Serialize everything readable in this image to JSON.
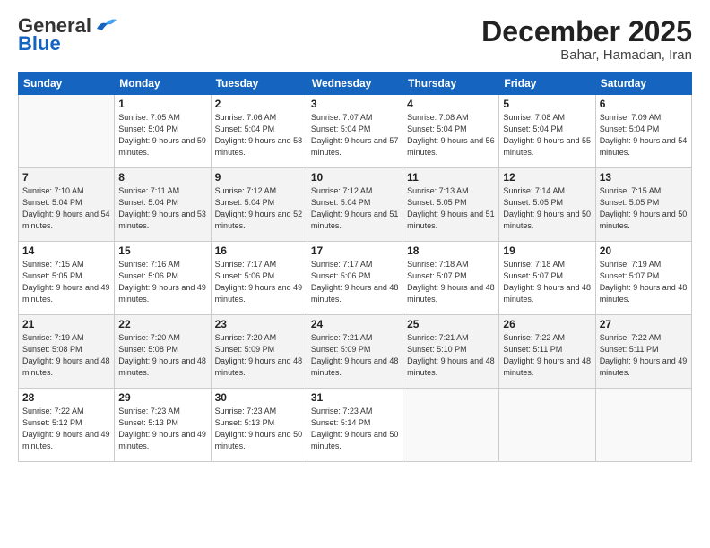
{
  "header": {
    "logo_general": "General",
    "logo_blue": "Blue",
    "month_title": "December 2025",
    "subtitle": "Bahar, Hamadan, Iran"
  },
  "weekdays": [
    "Sunday",
    "Monday",
    "Tuesday",
    "Wednesday",
    "Thursday",
    "Friday",
    "Saturday"
  ],
  "weeks": [
    [
      {
        "day": "",
        "sunrise": "",
        "sunset": "",
        "daylight": ""
      },
      {
        "day": "1",
        "sunrise": "Sunrise: 7:05 AM",
        "sunset": "Sunset: 5:04 PM",
        "daylight": "Daylight: 9 hours and 59 minutes."
      },
      {
        "day": "2",
        "sunrise": "Sunrise: 7:06 AM",
        "sunset": "Sunset: 5:04 PM",
        "daylight": "Daylight: 9 hours and 58 minutes."
      },
      {
        "day": "3",
        "sunrise": "Sunrise: 7:07 AM",
        "sunset": "Sunset: 5:04 PM",
        "daylight": "Daylight: 9 hours and 57 minutes."
      },
      {
        "day": "4",
        "sunrise": "Sunrise: 7:08 AM",
        "sunset": "Sunset: 5:04 PM",
        "daylight": "Daylight: 9 hours and 56 minutes."
      },
      {
        "day": "5",
        "sunrise": "Sunrise: 7:08 AM",
        "sunset": "Sunset: 5:04 PM",
        "daylight": "Daylight: 9 hours and 55 minutes."
      },
      {
        "day": "6",
        "sunrise": "Sunrise: 7:09 AM",
        "sunset": "Sunset: 5:04 PM",
        "daylight": "Daylight: 9 hours and 54 minutes."
      }
    ],
    [
      {
        "day": "7",
        "sunrise": "Sunrise: 7:10 AM",
        "sunset": "Sunset: 5:04 PM",
        "daylight": "Daylight: 9 hours and 54 minutes."
      },
      {
        "day": "8",
        "sunrise": "Sunrise: 7:11 AM",
        "sunset": "Sunset: 5:04 PM",
        "daylight": "Daylight: 9 hours and 53 minutes."
      },
      {
        "day": "9",
        "sunrise": "Sunrise: 7:12 AM",
        "sunset": "Sunset: 5:04 PM",
        "daylight": "Daylight: 9 hours and 52 minutes."
      },
      {
        "day": "10",
        "sunrise": "Sunrise: 7:12 AM",
        "sunset": "Sunset: 5:04 PM",
        "daylight": "Daylight: 9 hours and 51 minutes."
      },
      {
        "day": "11",
        "sunrise": "Sunrise: 7:13 AM",
        "sunset": "Sunset: 5:05 PM",
        "daylight": "Daylight: 9 hours and 51 minutes."
      },
      {
        "day": "12",
        "sunrise": "Sunrise: 7:14 AM",
        "sunset": "Sunset: 5:05 PM",
        "daylight": "Daylight: 9 hours and 50 minutes."
      },
      {
        "day": "13",
        "sunrise": "Sunrise: 7:15 AM",
        "sunset": "Sunset: 5:05 PM",
        "daylight": "Daylight: 9 hours and 50 minutes."
      }
    ],
    [
      {
        "day": "14",
        "sunrise": "Sunrise: 7:15 AM",
        "sunset": "Sunset: 5:05 PM",
        "daylight": "Daylight: 9 hours and 49 minutes."
      },
      {
        "day": "15",
        "sunrise": "Sunrise: 7:16 AM",
        "sunset": "Sunset: 5:06 PM",
        "daylight": "Daylight: 9 hours and 49 minutes."
      },
      {
        "day": "16",
        "sunrise": "Sunrise: 7:17 AM",
        "sunset": "Sunset: 5:06 PM",
        "daylight": "Daylight: 9 hours and 49 minutes."
      },
      {
        "day": "17",
        "sunrise": "Sunrise: 7:17 AM",
        "sunset": "Sunset: 5:06 PM",
        "daylight": "Daylight: 9 hours and 48 minutes."
      },
      {
        "day": "18",
        "sunrise": "Sunrise: 7:18 AM",
        "sunset": "Sunset: 5:07 PM",
        "daylight": "Daylight: 9 hours and 48 minutes."
      },
      {
        "day": "19",
        "sunrise": "Sunrise: 7:18 AM",
        "sunset": "Sunset: 5:07 PM",
        "daylight": "Daylight: 9 hours and 48 minutes."
      },
      {
        "day": "20",
        "sunrise": "Sunrise: 7:19 AM",
        "sunset": "Sunset: 5:07 PM",
        "daylight": "Daylight: 9 hours and 48 minutes."
      }
    ],
    [
      {
        "day": "21",
        "sunrise": "Sunrise: 7:19 AM",
        "sunset": "Sunset: 5:08 PM",
        "daylight": "Daylight: 9 hours and 48 minutes."
      },
      {
        "day": "22",
        "sunrise": "Sunrise: 7:20 AM",
        "sunset": "Sunset: 5:08 PM",
        "daylight": "Daylight: 9 hours and 48 minutes."
      },
      {
        "day": "23",
        "sunrise": "Sunrise: 7:20 AM",
        "sunset": "Sunset: 5:09 PM",
        "daylight": "Daylight: 9 hours and 48 minutes."
      },
      {
        "day": "24",
        "sunrise": "Sunrise: 7:21 AM",
        "sunset": "Sunset: 5:09 PM",
        "daylight": "Daylight: 9 hours and 48 minutes."
      },
      {
        "day": "25",
        "sunrise": "Sunrise: 7:21 AM",
        "sunset": "Sunset: 5:10 PM",
        "daylight": "Daylight: 9 hours and 48 minutes."
      },
      {
        "day": "26",
        "sunrise": "Sunrise: 7:22 AM",
        "sunset": "Sunset: 5:11 PM",
        "daylight": "Daylight: 9 hours and 48 minutes."
      },
      {
        "day": "27",
        "sunrise": "Sunrise: 7:22 AM",
        "sunset": "Sunset: 5:11 PM",
        "daylight": "Daylight: 9 hours and 49 minutes."
      }
    ],
    [
      {
        "day": "28",
        "sunrise": "Sunrise: 7:22 AM",
        "sunset": "Sunset: 5:12 PM",
        "daylight": "Daylight: 9 hours and 49 minutes."
      },
      {
        "day": "29",
        "sunrise": "Sunrise: 7:23 AM",
        "sunset": "Sunset: 5:13 PM",
        "daylight": "Daylight: 9 hours and 49 minutes."
      },
      {
        "day": "30",
        "sunrise": "Sunrise: 7:23 AM",
        "sunset": "Sunset: 5:13 PM",
        "daylight": "Daylight: 9 hours and 50 minutes."
      },
      {
        "day": "31",
        "sunrise": "Sunrise: 7:23 AM",
        "sunset": "Sunset: 5:14 PM",
        "daylight": "Daylight: 9 hours and 50 minutes."
      },
      {
        "day": "",
        "sunrise": "",
        "sunset": "",
        "daylight": ""
      },
      {
        "day": "",
        "sunrise": "",
        "sunset": "",
        "daylight": ""
      },
      {
        "day": "",
        "sunrise": "",
        "sunset": "",
        "daylight": ""
      }
    ]
  ]
}
